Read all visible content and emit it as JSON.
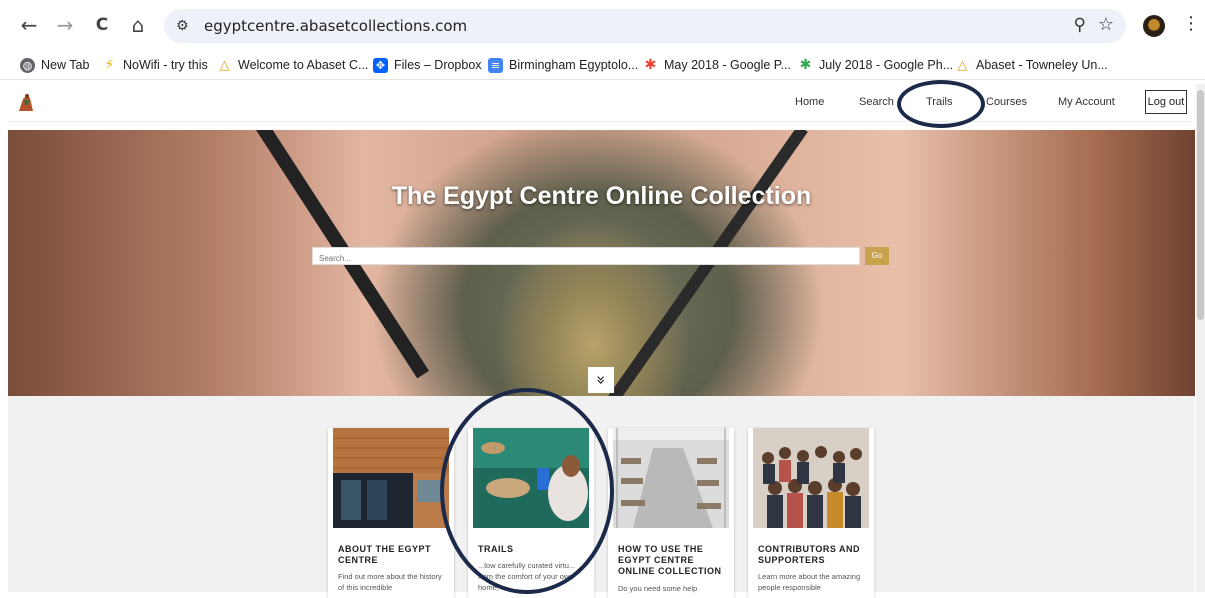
{
  "browser": {
    "url": "egyptcentre.abasetcollections.com",
    "back_icon": "←",
    "forward_icon": "→",
    "reload_icon": "C",
    "home_icon": "⌂",
    "zoom_icon": "⚲",
    "star_icon": "☆",
    "menu_icon": "⋮"
  },
  "bookmarks": [
    {
      "label": "New Tab",
      "icon": "globe-icon",
      "color": "#5f6368"
    },
    {
      "label": "NoWifi - try this",
      "icon": "bolt-icon",
      "color": "#f4b400"
    },
    {
      "label": "Welcome to Abaset C...",
      "icon": "abaset-icon",
      "color": "#e0a020"
    },
    {
      "label": "Files – Dropbox",
      "icon": "dropbox-icon",
      "color": "#0061fe"
    },
    {
      "label": "Birmingham Egyptolo...",
      "icon": "doc-icon",
      "color": "#4285f4"
    },
    {
      "label": "May 2018 - Google P...",
      "icon": "photos-icon",
      "color": "#ea4335"
    },
    {
      "label": "July 2018 - Google Ph...",
      "icon": "photos-icon",
      "color": "#ea4335"
    },
    {
      "label": "Abaset - Towneley Un...",
      "icon": "abaset-icon",
      "color": "#e0a020"
    }
  ],
  "site_nav": {
    "home": "Home",
    "search": "Search",
    "trails": "Trails",
    "courses": "Courses",
    "account": "My Account",
    "logout": "Log out"
  },
  "hero": {
    "title": "The Egypt Centre Online Collection",
    "search_placeholder": "Search...",
    "go_label": "Go",
    "scroll_icon": "»"
  },
  "cards": [
    {
      "title": "ABOUT THE EGYPT CENTRE",
      "text": "Find out more about the history of this incredible"
    },
    {
      "title": "TRAILS",
      "text": "...low carefully curated virtu...           from the comfort of your own home,"
    },
    {
      "title": "HOW TO USE THE EGYPT CENTRE ONLINE COLLECTION",
      "text": "Do you need some help"
    },
    {
      "title": "CONTRIBUTORS AND SUPPORTERS",
      "text": "Learn more about the amazing people responsible"
    }
  ],
  "colors": {
    "accent_gold": "#c9a24e",
    "annotation_navy": "#1b2a4a"
  }
}
